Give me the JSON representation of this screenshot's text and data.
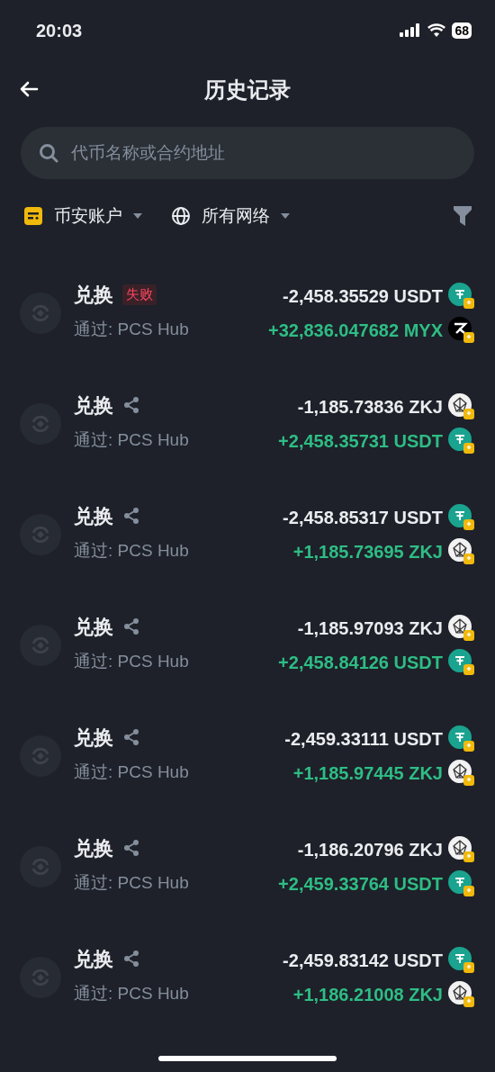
{
  "status_bar": {
    "time": "20:03",
    "battery": "68"
  },
  "header": {
    "title": "历史记录"
  },
  "search": {
    "placeholder": "代币名称或合约地址"
  },
  "filters": [
    {
      "kind": "account",
      "label": "币安账户"
    },
    {
      "kind": "network",
      "label": "所有网络"
    }
  ],
  "rows": [
    {
      "title": "兑换",
      "badge": "失败",
      "via": "通过: PCS Hub",
      "amounts": [
        {
          "kind": "out",
          "text": "-2,458.35529 USDT",
          "icon": {
            "kind": "usdt"
          }
        },
        {
          "kind": "in",
          "text": "+32,836.047682 MYX",
          "icon": {
            "kind": "myx"
          }
        }
      ]
    },
    {
      "title": "兑换",
      "via": "通过: PCS Hub",
      "amounts": [
        {
          "kind": "out",
          "text": "-1,185.73836 ZKJ",
          "icon": {
            "kind": "zkj"
          }
        },
        {
          "kind": "in",
          "text": "+2,458.35731 USDT",
          "icon": {
            "kind": "usdt"
          }
        }
      ]
    },
    {
      "title": "兑换",
      "via": "通过: PCS Hub",
      "amounts": [
        {
          "kind": "out",
          "text": "-2,458.85317 USDT",
          "icon": {
            "kind": "usdt"
          }
        },
        {
          "kind": "in",
          "text": "+1,185.73695 ZKJ",
          "icon": {
            "kind": "zkj"
          }
        }
      ]
    },
    {
      "title": "兑换",
      "via": "通过: PCS Hub",
      "amounts": [
        {
          "kind": "out",
          "text": "-1,185.97093 ZKJ",
          "icon": {
            "kind": "zkj"
          }
        },
        {
          "kind": "in",
          "text": "+2,458.84126 USDT",
          "icon": {
            "kind": "usdt"
          }
        }
      ]
    },
    {
      "title": "兑换",
      "via": "通过: PCS Hub",
      "amounts": [
        {
          "kind": "out",
          "text": "-2,459.33111 USDT",
          "icon": {
            "kind": "usdt"
          }
        },
        {
          "kind": "in",
          "text": "+1,185.97445 ZKJ",
          "icon": {
            "kind": "zkj"
          }
        }
      ]
    },
    {
      "title": "兑换",
      "via": "通过: PCS Hub",
      "amounts": [
        {
          "kind": "out",
          "text": "-1,186.20796 ZKJ",
          "icon": {
            "kind": "zkj"
          }
        },
        {
          "kind": "in",
          "text": "+2,459.33764 USDT",
          "icon": {
            "kind": "usdt"
          }
        }
      ]
    },
    {
      "title": "兑换",
      "via": "通过: PCS Hub",
      "amounts": [
        {
          "kind": "out",
          "text": "-2,459.83142 USDT",
          "icon": {
            "kind": "usdt"
          }
        },
        {
          "kind": "in",
          "text": "+1,186.21008 ZKJ",
          "icon": {
            "kind": "zkj"
          }
        }
      ]
    }
  ]
}
